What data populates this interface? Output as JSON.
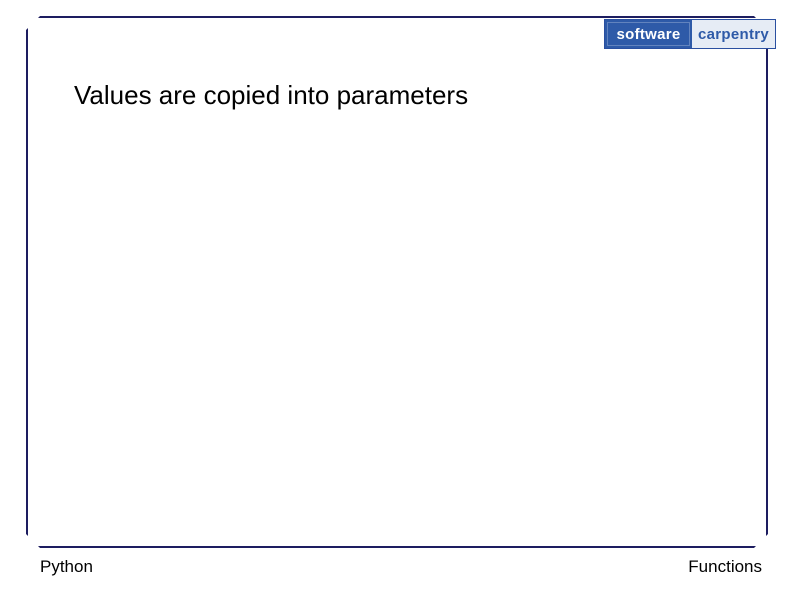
{
  "logo": {
    "left": "software",
    "right": "carpentry"
  },
  "heading": "Values are copied into parameters",
  "footer": {
    "left": "Python",
    "right": "Functions"
  }
}
